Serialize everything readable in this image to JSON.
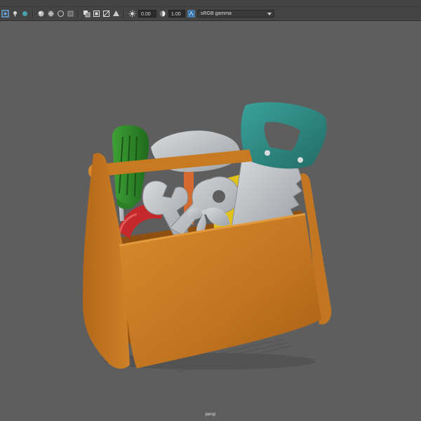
{
  "toolbar": {
    "exposure_value": "0.00",
    "gamma_value": "1.00",
    "color_space": "sRGB gamma",
    "icons": [
      "select-camera-icon",
      "light-icon",
      "isolate-icon",
      "grid-icon",
      "shading-icon",
      "textured-icon",
      "wireframe-icon",
      "xray-icon",
      "resolution-gate-icon",
      "film-gate-icon",
      "safe-action-icon",
      "exposure-icon",
      "gamma-icon",
      "color-management-icon"
    ]
  },
  "viewport": {
    "camera_label": "persp",
    "background_color": "#5e5e5e"
  },
  "model": {
    "colors": {
      "box": "#c0731c",
      "box_dark": "#8e4f10",
      "handle": "#c87a22",
      "screwdriver": "#2f8a2a",
      "saw_handle": "#2f8a84",
      "metal": "#b9bcc0",
      "red_tool": "#c4282a",
      "yellow": "#e1c21c"
    }
  }
}
